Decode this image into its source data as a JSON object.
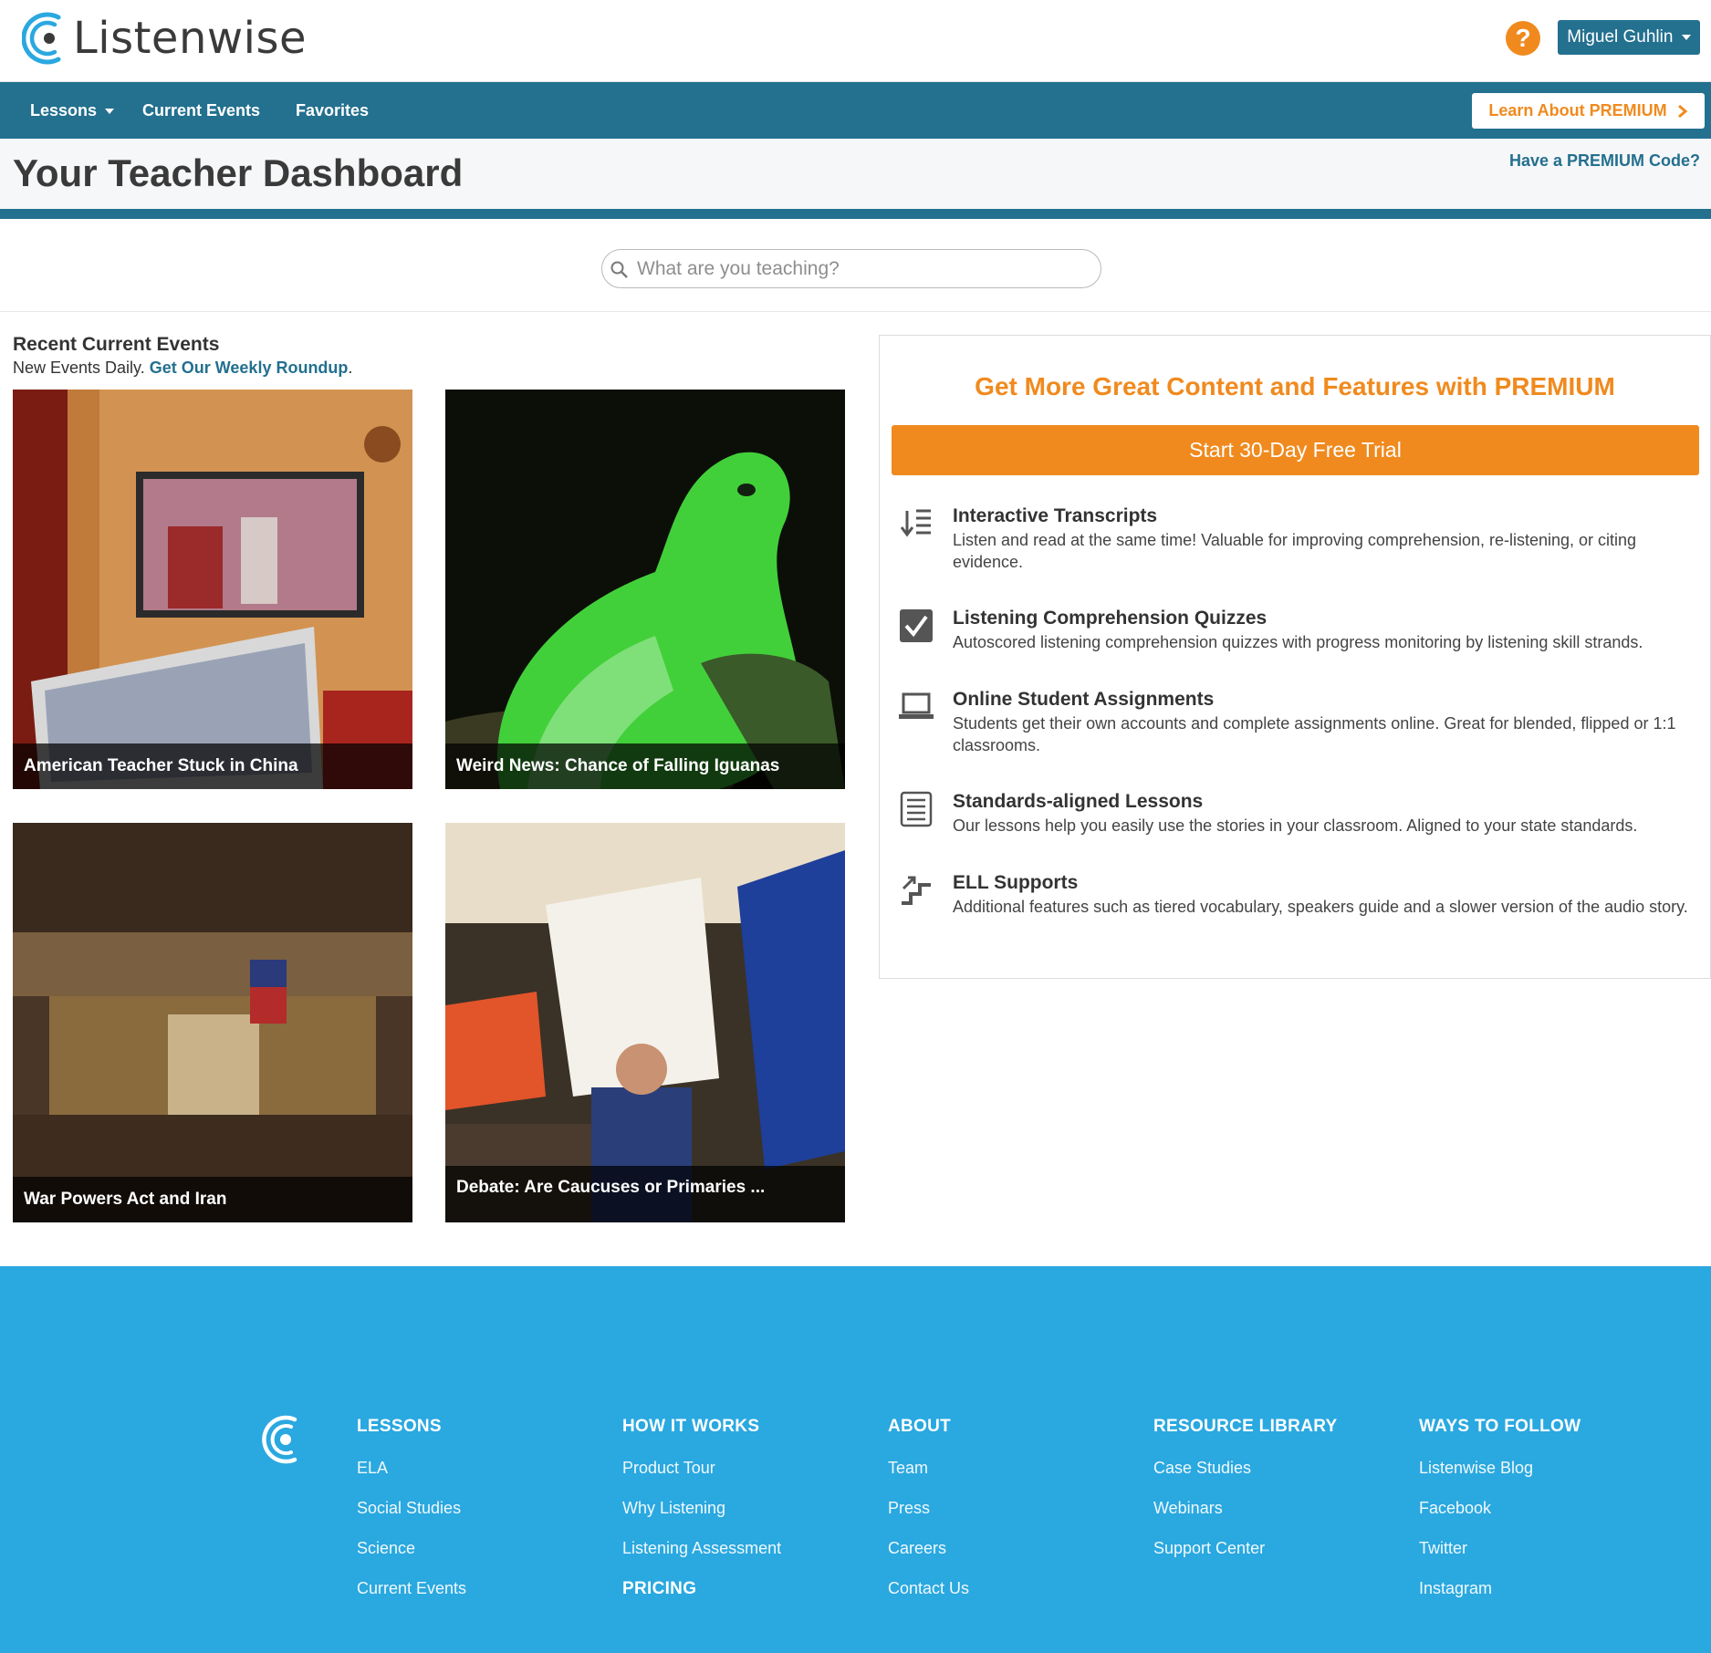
{
  "header": {
    "logo_text": "Listenwise",
    "help_label": "?",
    "user_name": "Miguel Guhlin"
  },
  "nav": {
    "lessons": "Lessons",
    "current_events": "Current Events",
    "favorites": "Favorites",
    "premium_button": "Learn About PREMIUM"
  },
  "dashboard": {
    "title": "Your Teacher Dashboard",
    "premium_code_link": "Have a PREMIUM Code?"
  },
  "search": {
    "placeholder": "What are you teaching?"
  },
  "recent": {
    "title": "Recent Current Events",
    "subtitle_prefix": "New Events Daily.",
    "roundup_link": "Get Our Weekly Roundup",
    "subtitle_suffix": ".",
    "cards": [
      {
        "caption": "American Teacher Stuck in China"
      },
      {
        "caption": "Weird News: Chance of Falling Iguanas"
      },
      {
        "caption": "War Powers Act and Iran"
      },
      {
        "caption": "Debate: Are Caucuses or Primaries ..."
      }
    ]
  },
  "premium_panel": {
    "title": "Get More Great Content and Features with PREMIUM",
    "trial_button": "Start 30-Day Free Trial",
    "features": [
      {
        "icon": "transcript-icon",
        "title": "Interactive Transcripts",
        "desc": "Listen and read at the same time! Valuable for improving comprehension, re-listening, or citing evidence."
      },
      {
        "icon": "checkbox-icon",
        "title": "Listening Comprehension Quizzes",
        "desc": "Autoscored listening comprehension quizzes with progress monitoring by listening skill strands."
      },
      {
        "icon": "laptop-icon",
        "title": "Online Student Assignments",
        "desc": "Students get their own accounts and complete assignments online. Great for blended, flipped or 1:1 classrooms."
      },
      {
        "icon": "list-icon",
        "title": "Standards-aligned Lessons",
        "desc": "Our lessons help you easily use the stories in your classroom. Aligned to your state standards."
      },
      {
        "icon": "stairs-icon",
        "title": "ELL Supports",
        "desc": "Additional features such as tiered vocabulary, speakers guide and a slower version of the audio story."
      }
    ]
  },
  "footer": {
    "columns": [
      {
        "heading": "LESSONS",
        "links": [
          "ELA",
          "Social Studies",
          "Science",
          "Current Events"
        ]
      },
      {
        "heading": "HOW IT WORKS",
        "links": [
          "Product Tour",
          "Why Listening",
          "Listening Assessment"
        ],
        "extra_heading": "PRICING"
      },
      {
        "heading": "ABOUT",
        "links": [
          "Team",
          "Press",
          "Careers",
          "Contact Us"
        ]
      },
      {
        "heading": "RESOURCE LIBRARY",
        "links": [
          "Case Studies",
          "Webinars",
          "Support Center"
        ]
      },
      {
        "heading": "WAYS TO FOLLOW",
        "links": [
          "Listenwise Blog",
          "Facebook",
          "Twitter",
          "Instagram"
        ]
      }
    ]
  },
  "colors": {
    "brand_blue": "#23708f",
    "accent_orange": "#f08a1e",
    "footer_blue": "#2aa8e0"
  }
}
